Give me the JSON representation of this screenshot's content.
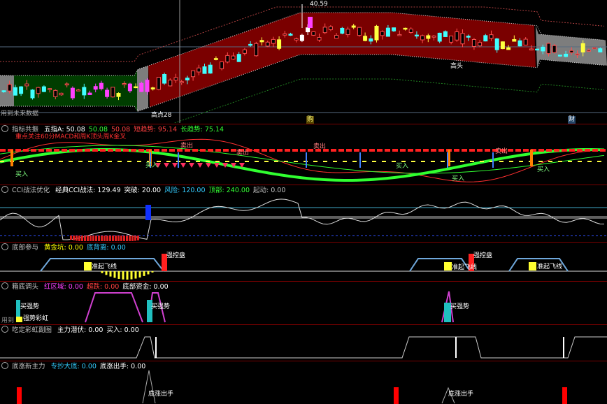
{
  "main": {
    "price_high_label": "40.59",
    "low_label": "高点28",
    "top_label": "高头",
    "future_text": "用到未来数据",
    "bottom_markers": [
      "购",
      "财"
    ]
  },
  "pane1": {
    "title": "指标共振",
    "fields": [
      {
        "text": "五指A: 50.08",
        "color": "#ffffff"
      },
      {
        "text": "50.08",
        "color": "#33ff33"
      },
      {
        "text": "50.08",
        "color": "#ff4040"
      },
      {
        "text": "短趋势: 95.14",
        "color": "#ff4040"
      },
      {
        "text": "长趋势: 75.14",
        "color": "#33ff33"
      }
    ],
    "note": "重点关注60分MACD和周K顶头周K金叉",
    "labels": [
      "卖出",
      "卖出",
      "卖出",
      "卖出",
      "买入",
      "买入",
      "买入",
      "买入",
      "买入"
    ]
  },
  "pane2": {
    "title": "CCI战法优化",
    "fields": [
      {
        "text": "经典CCI战法: 129.49",
        "color": "#ffffff"
      },
      {
        "text": "突破: 20.00",
        "color": "#ffffff"
      },
      {
        "text": "风险: 120.00",
        "color": "#33ccff"
      },
      {
        "text": "顶部: 240.00",
        "color": "#33ff33"
      },
      {
        "text": "起动: 0.00",
        "color": "#c0c0c0"
      }
    ]
  },
  "pane3": {
    "title": "底部参与",
    "fields": [
      {
        "text": "黄金坑: 0.00",
        "color": "#ffff00"
      },
      {
        "text": "底背离: 0.00",
        "color": "#33ccff"
      }
    ],
    "labels": [
      "准起飞线",
      "强控盘",
      "强控盘",
      "准起飞线",
      "准起飞线"
    ]
  },
  "pane4": {
    "title": "箱底调头",
    "fields": [
      {
        "text": "红区域: 0.00",
        "color": "#ff40ff"
      },
      {
        "text": "超跌: 0.00",
        "color": "#ff4040"
      },
      {
        "text": "底部资金: 0.00",
        "color": "#ffffff"
      }
    ],
    "labels": [
      "买强势",
      "强势彩虹",
      "买强势",
      "买强势"
    ],
    "future_text": "用到"
  },
  "pane5": {
    "title": "吃定彩虹副图",
    "fields": [
      {
        "text": "主力潜伏: 0.00",
        "color": "#ffffff"
      },
      {
        "text": "买入: 0.00",
        "color": "#ffffff"
      }
    ]
  },
  "pane6": {
    "title": "底涨新主力",
    "fields": [
      {
        "text": "专抄大底: 0.00",
        "color": "#33ccff"
      },
      {
        "text": "底涨出手: 0.00",
        "color": "#ffffff"
      }
    ],
    "labels": [
      "底涨出手",
      "底涨出手"
    ]
  },
  "colors": {
    "bg": "#000000",
    "up": "#ff4040",
    "down": "#33ffff",
    "separator": "#7a0000",
    "band_red": "#7a0000",
    "band_green": "#003d00",
    "band_gray": "#7d7d7d"
  }
}
